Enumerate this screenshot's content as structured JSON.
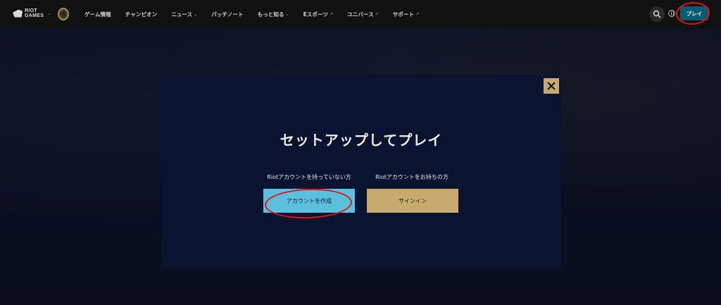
{
  "nav": {
    "riot_logo_line1": "RIOT",
    "riot_logo_line2": "GAMES",
    "items": [
      {
        "label": "ゲーム情報",
        "caret": ""
      },
      {
        "label": "チャンピオン",
        "caret": ""
      },
      {
        "label": "ニュース",
        "caret": "⌄"
      },
      {
        "label": "パッチノート",
        "caret": ""
      },
      {
        "label": "もっと知る",
        "caret": "⌄"
      },
      {
        "label": "Eスポーツ",
        "caret": "↗"
      },
      {
        "label": "ユニバース",
        "caret": "↗"
      },
      {
        "label": "サポート",
        "caret": "↗"
      }
    ],
    "play_label": "プレイ",
    "icons": [
      "riot-games-logo",
      "league-of-legends-logo",
      "search-icon",
      "globe-icon"
    ]
  },
  "modal": {
    "title": "セットアップしてプレイ",
    "no_account_label": "Riotアカウントを持っていない方",
    "has_account_label": "Riotアカウントをお持ちの方",
    "create_account_button": "アカウントを作成",
    "sign_in_button": "サインイン",
    "close_icon": "close-icon"
  },
  "colors": {
    "nav_bg": "#111111",
    "modal_bg": "#0a1330",
    "create_button": "#5bc0de",
    "gold": "#c8aa6e",
    "play_button": "#0a5a75",
    "annotation": "#e81010"
  }
}
